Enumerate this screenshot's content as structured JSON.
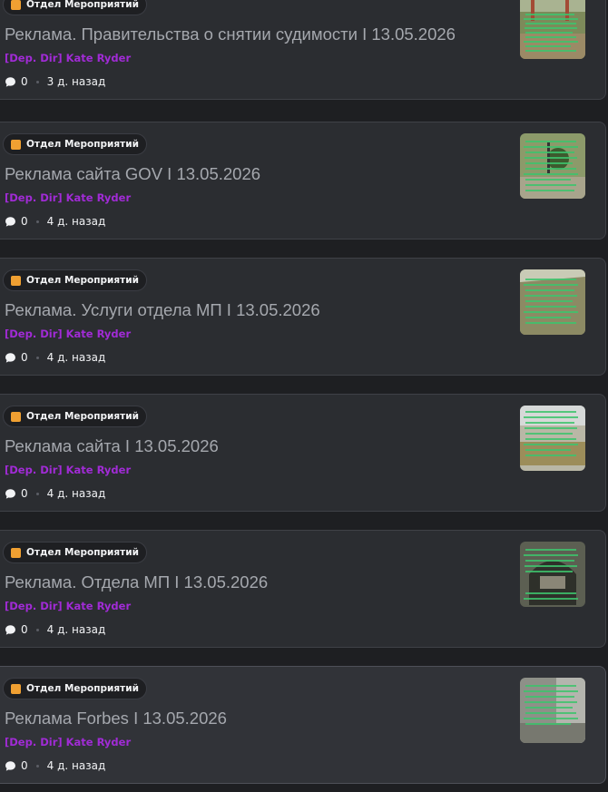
{
  "posts": [
    {
      "tag": "Отдел Мероприятий",
      "title": "Реклама. Правительства о снятии судимости I 13.05.2026",
      "author": "[Dep. Dir] Kate Ryder",
      "comments": "0",
      "time": "3 д. назад"
    },
    {
      "tag": "Отдел Мероприятий",
      "title": "Реклама сайта GOV I 13.05.2026",
      "author": "[Dep. Dir] Kate Ryder",
      "comments": "0",
      "time": "4 д. назад"
    },
    {
      "tag": "Отдел Мероприятий",
      "title": "Реклама. Услуги отдела МП I 13.05.2026",
      "author": "[Dep. Dir] Kate Ryder",
      "comments": "0",
      "time": "4 д. назад"
    },
    {
      "tag": "Отдел Мероприятий",
      "title": "Реклама сайта I 13.05.2026",
      "author": "[Dep. Dir] Kate Ryder",
      "comments": "0",
      "time": "4 д. назад"
    },
    {
      "tag": "Отдел Мероприятий",
      "title": "Реклама. Отдела МП I 13.05.2026",
      "author": "[Dep. Dir] Kate Ryder",
      "comments": "0",
      "time": "4 д. назад"
    },
    {
      "tag": "Отдел Мероприятий",
      "title": "Реклама Forbes I 13.05.2026",
      "author": "[Dep. Dir] Kate Ryder",
      "comments": "0",
      "time": "4 д. назад"
    }
  ],
  "colors": {
    "tag_square": "#f0a032",
    "author": "#a12bd6",
    "card_bg": "#2b2d31"
  },
  "icons": {
    "tag": "tag-square-icon",
    "comments": "speech-bubble-icon"
  }
}
